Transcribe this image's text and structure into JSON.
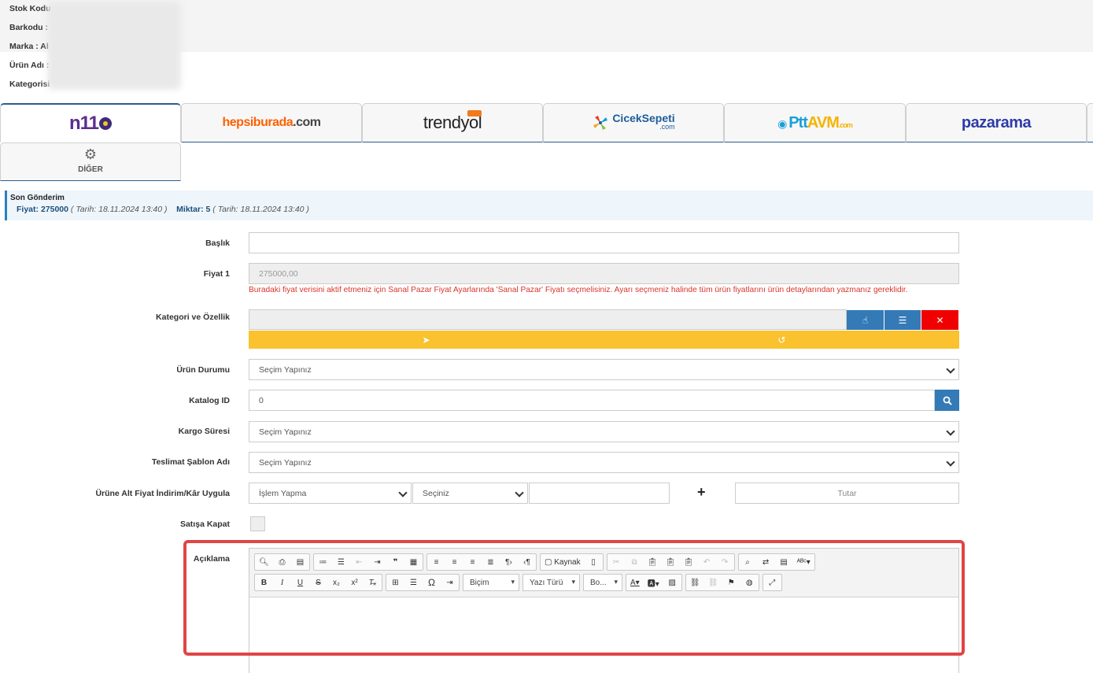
{
  "product_info": {
    "stock_code_label": "Stok Kodu",
    "barcode_label": "Barkodu :",
    "brand_label": "Marka : Al",
    "product_name_label": "Ürün Adı :",
    "category_label": "Kategorisi"
  },
  "tabs": [
    {
      "name": "n11"
    },
    {
      "name": "hepsiburada.com"
    },
    {
      "name": "trendyol"
    },
    {
      "name": "CicekSepeti.com"
    },
    {
      "name": "PttAVM.com"
    },
    {
      "name": "pazarama"
    }
  ],
  "logos": {
    "n11": "n11",
    "hb_main": "hepsiburada",
    "hb_suffix": ".com",
    "trendyol": "trendyol",
    "ciceksepeti_main": "CicekSepeti",
    "ciceksepeti_suffix": ".com",
    "ptt_main": "Ptt",
    "ptt_suffix": "AVM",
    "ptt_com": ".com",
    "pazarama": "pazarama"
  },
  "other_tab": {
    "label": "DİĞER",
    "icon": "gears-icon"
  },
  "last_sent": {
    "title": "Son Gönderim",
    "price_label": "Fiyat:",
    "price_value": "275000",
    "price_date": "( Tarih: 18.11.2024 13:40 )",
    "qty_label": "Miktar:",
    "qty_value": "5",
    "qty_date": "( Tarih: 18.11.2024 13:40 )"
  },
  "form": {
    "title_label": "Başlık",
    "title_value": "",
    "price_label": "Fiyat 1",
    "price_value": "275000,00",
    "price_warning": "Buradaki fiyat verisini aktif etmeniz için Sanal Pazar Fiyat Ayarlarında 'Sanal Pazar' Fiyatı seçmelisiniz. Ayarı seçmeniz halinde tüm ürün fiyatlarını ürün detaylarından yazmanız gereklidir.",
    "category_label": "Kategori ve Özellik",
    "condition_label": "Ürün Durumu",
    "condition_value": "Seçim Yapınız",
    "catalog_label": "Katalog ID",
    "catalog_value": "0",
    "shipping_label": "Kargo Süresi",
    "shipping_value": "Seçim Yapınız",
    "template_label": "Teslimat Şablon Adı",
    "template_value": "Seçim Yapınız",
    "discount_label": "Ürüne Alt Fiyat İndirim/Kâr Uygula",
    "discount_op": "İşlem Yapma",
    "discount_type": "Seçiniz",
    "discount_amount": "",
    "plus": "+",
    "amount_placeholder": "Tutar",
    "close_sale_label": "Satışa Kapat",
    "description_label": "Açıklama"
  },
  "editor": {
    "source_label": "Kaynak",
    "format_label": "Biçim",
    "font_label": "Yazı Türü",
    "size_label": "Bo..."
  },
  "colors": {
    "primary_blue": "#337ab7",
    "danger_red": "#f00000",
    "warning_yellow": "#f9c22e",
    "highlight_red": "#e04545"
  }
}
